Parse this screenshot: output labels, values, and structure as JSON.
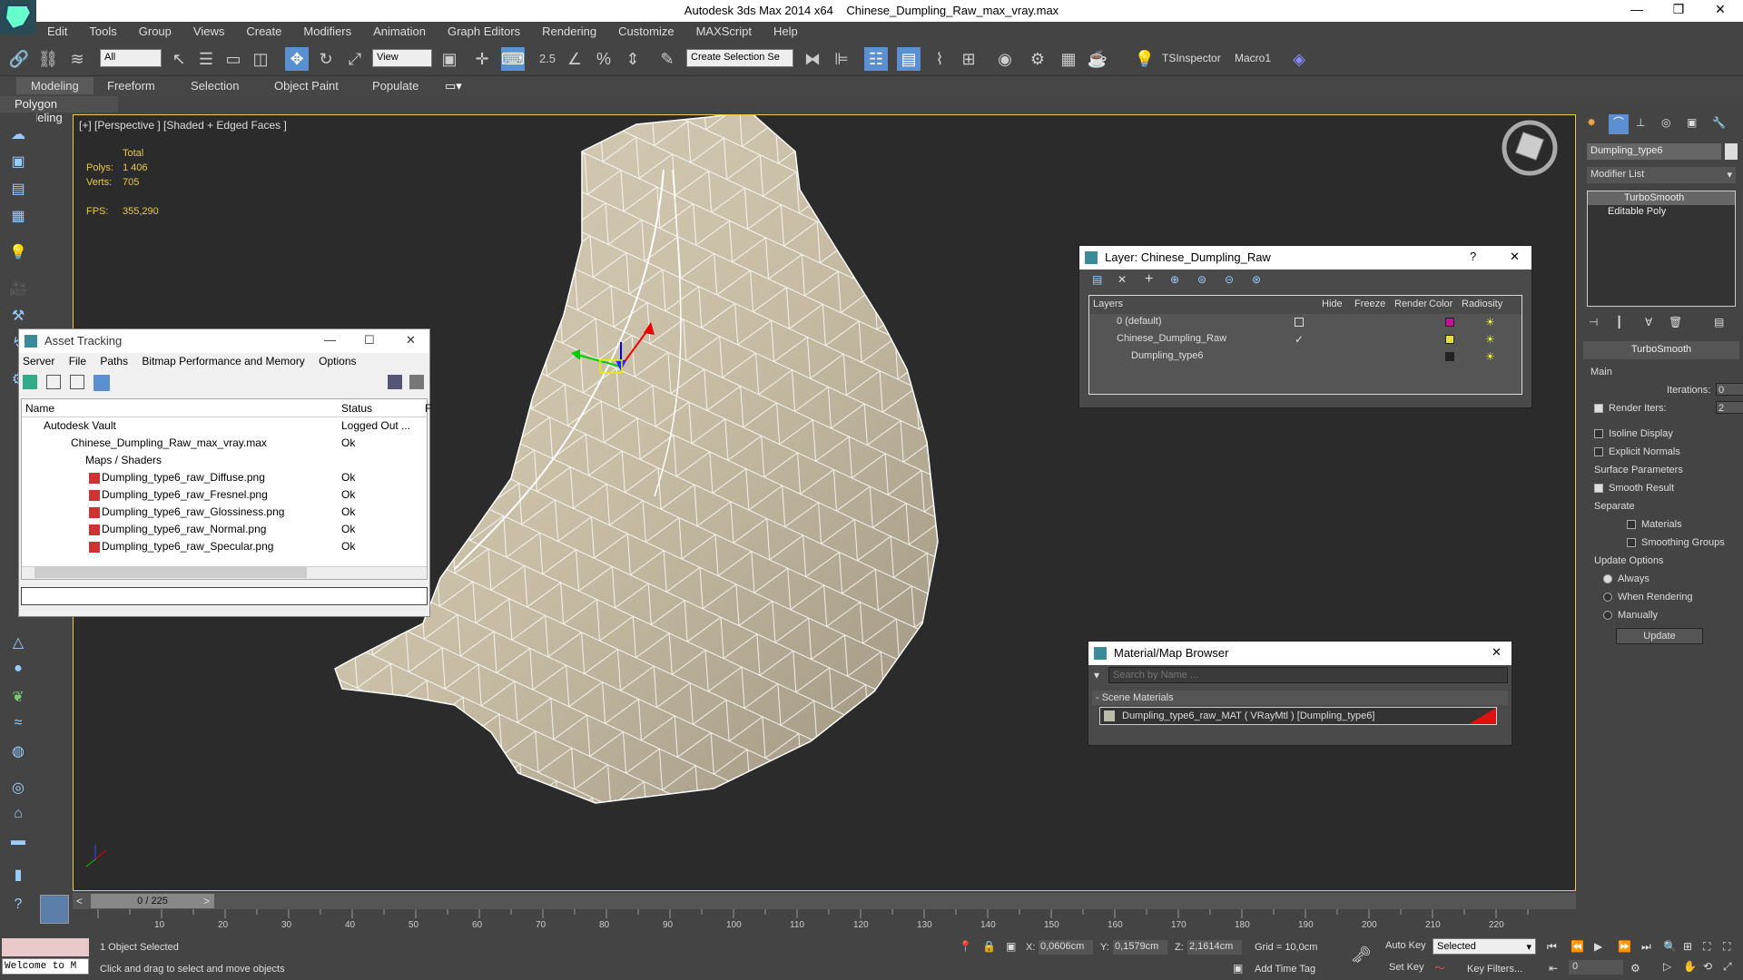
{
  "window": {
    "app": "Autodesk 3ds Max  2014 x64",
    "file": "Chinese_Dumpling_Raw_max_vray.max"
  },
  "menu": [
    "Edit",
    "Tools",
    "Group",
    "Views",
    "Create",
    "Modifiers",
    "Animation",
    "Graph Editors",
    "Rendering",
    "Customize",
    "MAXScript",
    "Help"
  ],
  "toolbar": {
    "filter": "All",
    "ref_coord": "View",
    "snap_value": "2.5",
    "selection_set": "Create Selection Se",
    "tsinspector": "TSInspector",
    "macro": "Macro1"
  },
  "ribbon": {
    "tabs": [
      "Modeling",
      "Freeform",
      "Selection",
      "Object Paint",
      "Populate"
    ],
    "sub": "Polygon Modeling"
  },
  "viewport": {
    "label": "[+] [Perspective ] [Shaded + Edged Faces ]",
    "stats": {
      "total_label": "Total",
      "polys_label": "Polys:",
      "polys": "1 406",
      "verts_label": "Verts:",
      "verts": "705",
      "fps_label": "FPS:",
      "fps": "355,290"
    }
  },
  "asset_tracking": {
    "title": "Asset Tracking",
    "menu": [
      "Server",
      "File",
      "Paths",
      "Bitmap Performance and Memory",
      "Options"
    ],
    "columns": [
      "Name",
      "Status",
      "F"
    ],
    "rows": [
      {
        "name": "Autodesk Vault",
        "status": "Logged Out ..."
      },
      {
        "name": "Chinese_Dumpling_Raw_max_vray.max",
        "status": "Ok"
      },
      {
        "name": "Maps / Shaders",
        "status": ""
      },
      {
        "name": "Dumpling_type6_raw_Diffuse.png",
        "status": "Ok"
      },
      {
        "name": "Dumpling_type6_raw_Fresnel.png",
        "status": "Ok"
      },
      {
        "name": "Dumpling_type6_raw_Glossiness.png",
        "status": "Ok"
      },
      {
        "name": "Dumpling_type6_raw_Normal.png",
        "status": "Ok"
      },
      {
        "name": "Dumpling_type6_raw_Specular.png",
        "status": "Ok"
      }
    ]
  },
  "layer_panel": {
    "title": "Layer: Chinese_Dumpling_Raw",
    "help": "?",
    "columns": [
      "Layers",
      "Hide",
      "Freeze",
      "Render",
      "Color",
      "Radiosity"
    ],
    "rows": [
      {
        "name": "0 (default)",
        "color": "#c4119a"
      },
      {
        "name": "Chinese_Dumpling_Raw",
        "color": "#e6e030"
      },
      {
        "name": "Dumpling_type6",
        "color": "#222222"
      }
    ]
  },
  "material_browser": {
    "title": "Material/Map Browser",
    "search_placeholder": "Search by Name ...",
    "group": "- Scene Materials",
    "item": "Dumpling_type6_raw_MAT  ( VRayMtl )  [Dumpling_type6]"
  },
  "command_panel": {
    "object_name": "Dumpling_type6",
    "modifier_list": "Modifier List",
    "stack": [
      "TurboSmooth",
      "Editable Poly"
    ],
    "rollout_title": "TurboSmooth",
    "main_label": "Main",
    "iterations_label": "Iterations:",
    "iterations": "0",
    "render_iters_label": "Render Iters:",
    "render_iters": "2",
    "isoline": "Isoline Display",
    "explicit": "Explicit Normals",
    "surface_params": "Surface Parameters",
    "smooth_result": "Smooth Result",
    "separate": "Separate",
    "materials": "Materials",
    "smoothing_groups": "Smoothing Groups",
    "update_options": "Update Options",
    "always": "Always",
    "when_rendering": "When Rendering",
    "manually": "Manually",
    "update_btn": "Update"
  },
  "timeline": {
    "frame": "0 / 225",
    "ticks": [
      "10",
      "20",
      "30",
      "40",
      "50",
      "60",
      "70",
      "80",
      "90",
      "100",
      "110",
      "120",
      "130",
      "140",
      "150",
      "160",
      "170",
      "180",
      "190",
      "200",
      "210",
      "220"
    ]
  },
  "status": {
    "welcome": "Welcome to M",
    "selected": "1 Object Selected",
    "hint": "Click and drag to select and move objects",
    "x_label": "X:",
    "x": "0,0606cm",
    "y_label": "Y:",
    "y": "0,1579cm",
    "z_label": "Z:",
    "z": "2,1614cm",
    "grid": "Grid = 10,0cm",
    "add_time_tag": "Add Time Tag",
    "auto_key": "Auto Key",
    "set_key": "Set Key",
    "selected_dropdown": "Selected",
    "key_filters": "Key Filters...",
    "frame_field": "0"
  }
}
